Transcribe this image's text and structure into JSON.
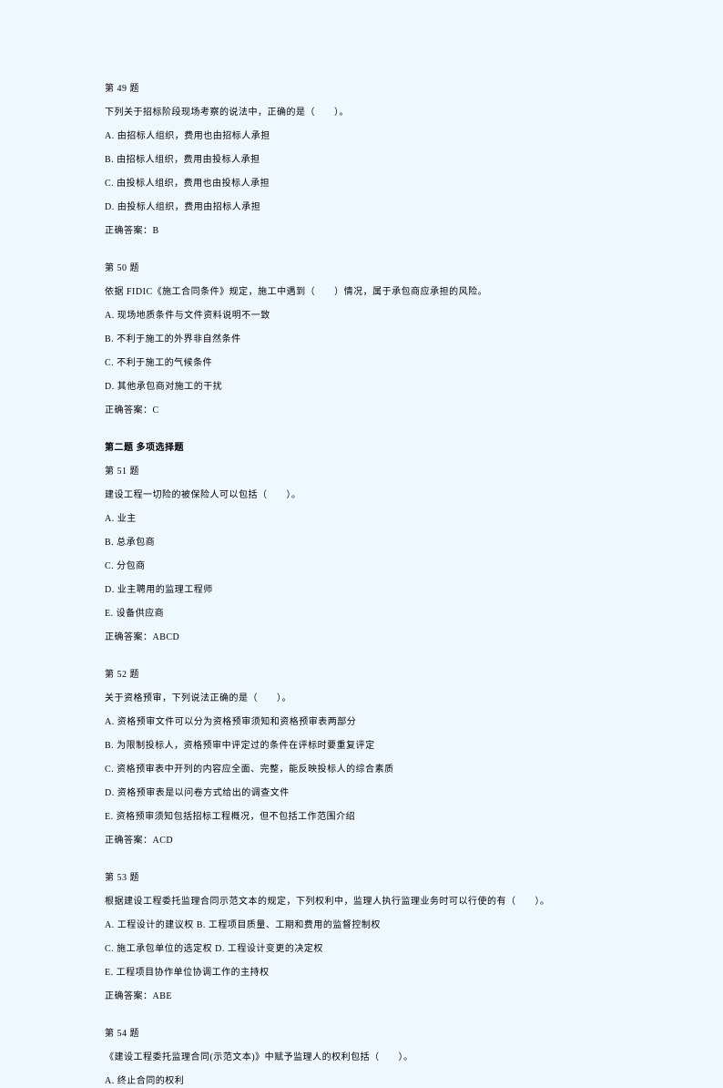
{
  "questions": [
    {
      "header": "第 49 题",
      "stem": "下列关于招标阶段现场考察的说法中，正确的是（　　）。",
      "options": [
        "A. 由招标人组织，费用也由招标人承担",
        "B. 由招标人组织，费用由投标人承担",
        "C. 由投标人组织，费用也由投标人承担",
        "D. 由投标人组织，费用由招标人承担"
      ],
      "answer": "正确答案：B"
    },
    {
      "header": "第 50 题",
      "stem": "依据 FIDIC《施工合同条件》规定，施工中遇到（　　）情况，属于承包商应承担的风险。",
      "options": [
        "A. 现场地质条件与文件资料说明不一致",
        "B. 不利于施工的外界非自然条件",
        "C. 不利于施工的气候条件",
        "D. 其他承包商对施工的干扰"
      ],
      "answer": "正确答案：C"
    }
  ],
  "section2": {
    "title": "第二题  多项选择题"
  },
  "questions2": [
    {
      "header": "第 51 题",
      "stem": "建设工程一切险的被保险人可以包括（　　）。",
      "options": [
        "A. 业主",
        "B. 总承包商",
        "C. 分包商",
        "D. 业主聘用的监理工程师",
        "E. 设备供应商"
      ],
      "answer": "正确答案：ABCD"
    },
    {
      "header": "第 52 题",
      "stem": "关于资格预审，下列说法正确的是（　　）。",
      "options": [
        "A. 资格预审文件可以分为资格预审须知和资格预审表两部分",
        "B. 为限制投标人，资格预审中评定过的条件在评标时要重复评定",
        "C. 资格预审表中开列的内容应全面、完整，能反映投标人的综合素质",
        "D. 资格预审表是以问卷方式给出的调查文件",
        "E. 资格预审须知包括招标工程概况，但不包括工作范围介绍"
      ],
      "answer": "正确答案：ACD"
    },
    {
      "header": "第 53 题",
      "stem": "根据建设工程委托监理合同示范文本的规定，下列权利中，监理人执行监理业务时可以行使的有（　　）。",
      "options": [
        "A. 工程设计的建议权  B. 工程项目质量、工期和费用的监督控制权",
        "C. 施工承包单位的选定权  D. 工程设计变更的决定权",
        "E. 工程项目协作单位协调工作的主持权"
      ],
      "answer": "正确答案：ABE"
    },
    {
      "header": "第 54 题",
      "stem": "《建设工程委托监理合同(示范文本)》中赋予监理人的权利包括（　　）。",
      "options": [
        "A. 终止合同的权利"
      ],
      "answer": ""
    }
  ]
}
